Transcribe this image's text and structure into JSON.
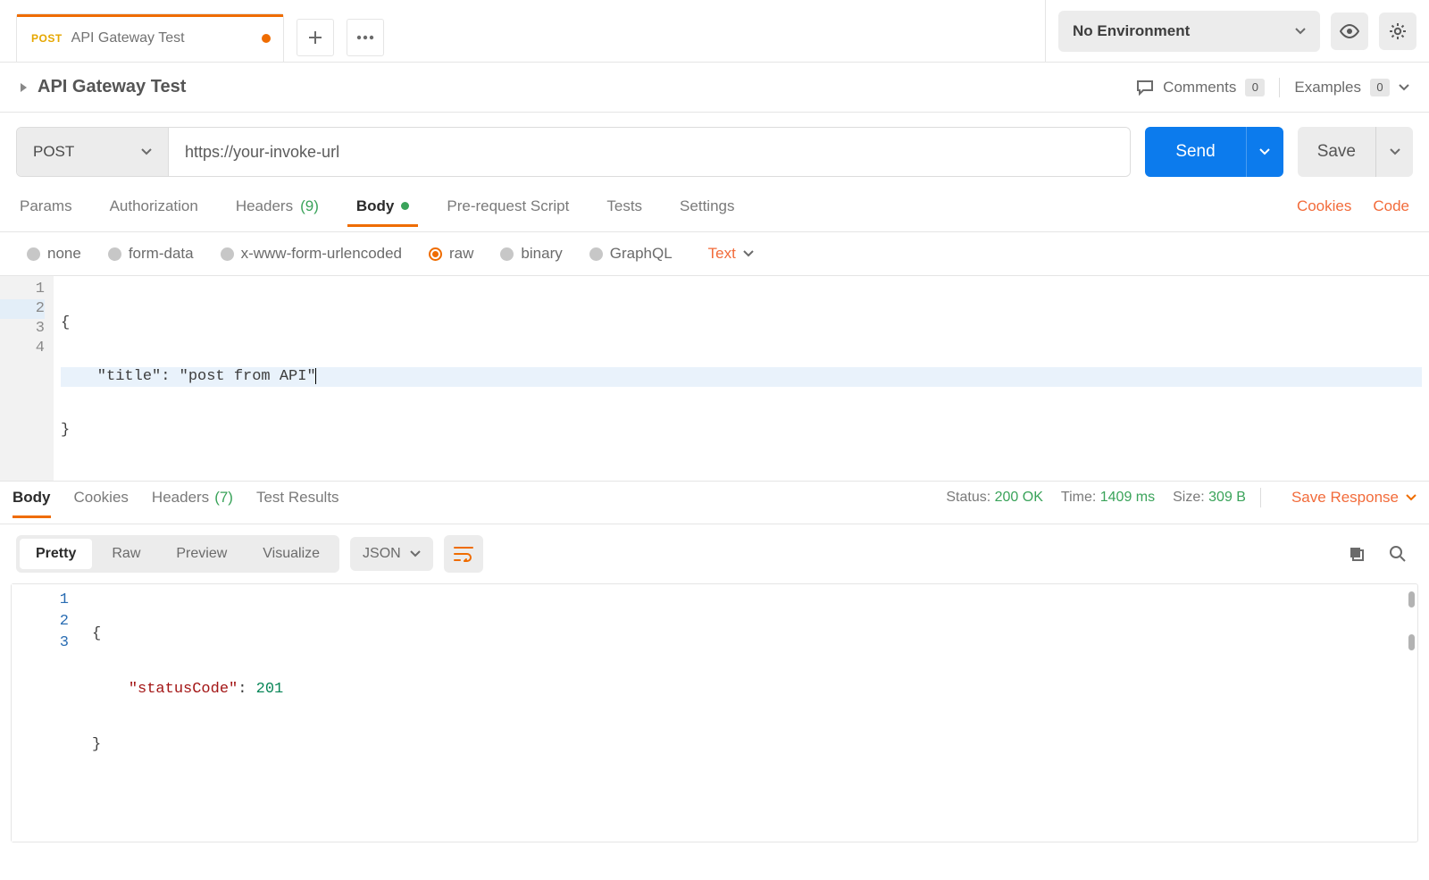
{
  "tab": {
    "method": "POST",
    "title": "API Gateway Test"
  },
  "env": {
    "label": "No Environment"
  },
  "request": {
    "name": "API Gateway Test",
    "comments_label": "Comments",
    "comments_count": "0",
    "examples_label": "Examples",
    "examples_count": "0",
    "method": "POST",
    "url": "https://your-invoke-url",
    "send": "Send",
    "save": "Save"
  },
  "reqTabs": {
    "params": "Params",
    "auth": "Authorization",
    "headers_label": "Headers",
    "headers_count": "(9)",
    "body": "Body",
    "prereq": "Pre-request Script",
    "tests": "Tests",
    "settings": "Settings",
    "cookies": "Cookies",
    "code": "Code"
  },
  "bodyTypes": {
    "none": "none",
    "formdata": "form-data",
    "urlenc": "x-www-form-urlencoded",
    "raw": "raw",
    "binary": "binary",
    "graphql": "GraphQL",
    "datatype": "Text"
  },
  "reqBody": {
    "l1": "{",
    "l2": "    \"title\": \"post from API\"",
    "l3": "}",
    "n1": "1",
    "n2": "2",
    "n3": "3",
    "n4": "4"
  },
  "respTabs": {
    "body": "Body",
    "cookies": "Cookies",
    "headers_label": "Headers",
    "headers_count": "(7)",
    "tests": "Test Results"
  },
  "respStatus": {
    "status_l": "Status:",
    "status_v": "200 OK",
    "time_l": "Time:",
    "time_v": "1409 ms",
    "size_l": "Size:",
    "size_v": "309 B",
    "save": "Save Response"
  },
  "respToolbar": {
    "pretty": "Pretty",
    "raw": "Raw",
    "preview": "Preview",
    "visualize": "Visualize",
    "format": "JSON"
  },
  "respBody": {
    "n1": "1",
    "n2": "2",
    "n3": "3",
    "l1": "{",
    "l2_key": "\"statusCode\"",
    "l2_colon": ": ",
    "l2_val": "201",
    "l3": "}"
  }
}
